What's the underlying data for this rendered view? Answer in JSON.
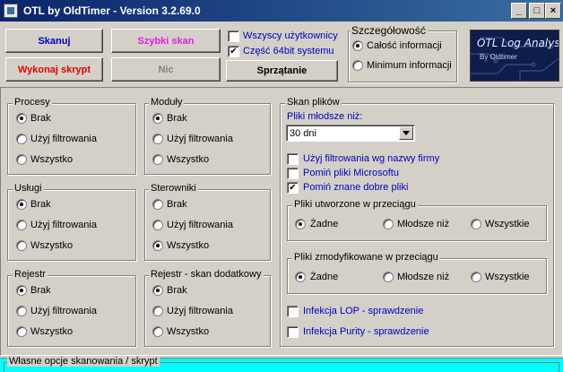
{
  "window": {
    "title": "OTL by OldTimer - Version 3.2.69.0",
    "minimize": "_",
    "maximize": "□",
    "close": "×"
  },
  "toolbar": {
    "scan": "Skanuj",
    "quick_scan": "Szybki skan",
    "run_script": "Wykonaj skrypt",
    "nothing": "Nic",
    "cleanup": "Sprzątanie",
    "all_users": "Wszyscy użytkownicy",
    "part_64bit": "Część 64bit systemu"
  },
  "detail": {
    "title": "Szczegółowość",
    "full": "Całość informacji",
    "minimum": "Minimum informacji"
  },
  "banner": {
    "title": "OTL Log Analysis",
    "subtitle": "By Oldtimer"
  },
  "groups": {
    "procesy": {
      "title": "Procesy",
      "brak": "Brak",
      "filter": "Użyj filtrowania",
      "all": "Wszystko"
    },
    "moduly": {
      "title": "Moduły",
      "brak": "Brak",
      "filter": "Użyj filtrowania",
      "all": "Wszystko"
    },
    "uslugi": {
      "title": "Usługi",
      "brak": "Brak",
      "filter": "Użyj filtrowania",
      "all": "Wszystko"
    },
    "sterowniki": {
      "title": "Sterowniki",
      "brak": "Brak",
      "filter": "Użyj filtrowania",
      "all": "Wszystko"
    },
    "rejestr": {
      "title": "Rejestr",
      "brak": "Brak",
      "filter": "Użyj filtrowania",
      "all": "Wszystko"
    },
    "rejestr_dod": {
      "title": "Rejestr - skan dodatkowy",
      "brak": "Brak",
      "filter": "Użyj filtrowania",
      "all": "Wszystko"
    }
  },
  "file_scan": {
    "title": "Skan plików",
    "younger_label": "Pliki młodsze niż:",
    "younger_value": "30 dni",
    "filter_company": "Użyj filtrowania wg nazwy firmy",
    "skip_microsoft": "Pomiń pliki Microsoftu",
    "skip_known": "Pomiń znane dobre pliki",
    "created": {
      "title": "Pliki utworzone w przeciągu",
      "none": "Żadne",
      "younger": "Młodsze niż",
      "all": "Wszystkie"
    },
    "modified": {
      "title": "Pliki zmodyfikowane w przeciągu",
      "none": "Żadne",
      "younger": "Młodsze niż",
      "all": "Wszystkie"
    },
    "lop": "Infekcja LOP - sprawdzenie",
    "purity": "Infekcja Purity - sprawdzenie"
  },
  "custom": {
    "title": "Własne opcje skanowania / skrypt"
  },
  "colors": {
    "scan": "#0000c0",
    "quick": "#e020e0",
    "run": "#e00000",
    "disabled": "#808080",
    "accent": "#00ffff"
  }
}
